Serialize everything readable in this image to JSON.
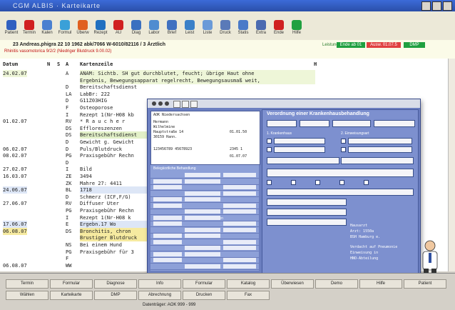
{
  "window": {
    "title": "CGM ALBIS · Karteikarte"
  },
  "toolbar": {
    "buttons": [
      {
        "label": "Patient",
        "icon": "pen-icon",
        "color": "#3060c0"
      },
      {
        "label": "Termin",
        "icon": "heart-icon",
        "color": "#d02020"
      },
      {
        "label": "Kalen",
        "icon": "calendar-icon",
        "color": "#4a80d0"
      },
      {
        "label": "Formul",
        "icon": "form-icon",
        "color": "#3aa0d8"
      },
      {
        "label": "Überw",
        "icon": "person-icon",
        "color": "#e06020"
      },
      {
        "label": "Rezept",
        "icon": "rx-icon",
        "color": "#2070c0"
      },
      {
        "label": "AU",
        "icon": "stop-icon",
        "color": "#d02020"
      },
      {
        "label": "Diag",
        "icon": "doc-icon",
        "color": "#3a70c0"
      },
      {
        "label": "Labor",
        "icon": "flask-icon",
        "color": "#508cd0"
      },
      {
        "label": "Brief",
        "icon": "pencil-icon",
        "color": "#4070c0"
      },
      {
        "label": "Leist",
        "icon": "chart-icon",
        "color": "#3a80c8"
      },
      {
        "label": "Liste",
        "icon": "list-icon",
        "color": "#6a9ad8"
      },
      {
        "label": "Druck",
        "icon": "printer-icon",
        "color": "#5a7ab8"
      },
      {
        "label": "Statis",
        "icon": "stats-icon",
        "color": "#4a7ac8"
      },
      {
        "label": "Extra",
        "icon": "disk-icon",
        "color": "#4a6ab0"
      },
      {
        "label": "Ende",
        "icon": "close-icon",
        "color": "#d02020"
      },
      {
        "label": "Hilfe",
        "icon": "check-icon",
        "color": "#20a040"
      }
    ]
  },
  "patient": {
    "name_line": "23 Andreas.phigra 22 10 1962 abk/7066 W-6010/82116 / 3 Ärztlich",
    "warning": "Rhinitis vasomotorica 9/2/2 (Niedriger Blutdruck 9.00.02)",
    "status_label": "Leistungen",
    "badges": [
      {
        "text": "Ende ab 01",
        "color": "#20a040"
      },
      {
        "text": "Ausw. 01.07.5",
        "color": "#e04040"
      },
      {
        "text": "DMP",
        "color": "#20a040"
      }
    ]
  },
  "grid": {
    "headers": {
      "datum": "Datum",
      "n": "N",
      "s": "S",
      "a": "A",
      "karte": "Kartenzeile",
      "extra": "H"
    },
    "rows": [
      {
        "datum": "24.02.07",
        "code": "A",
        "text": "ANAM: Sichtb. SH gut durchblutet, feucht; übrige Haut ohne",
        "hl": "#eef6d8"
      },
      {
        "datum": "",
        "code": "",
        "text": "Ergebnis, Bewegungsapparat regelrecht, Bewegungsausmaß weit,",
        "hl": "#eef6d8"
      },
      {
        "datum": "",
        "code": "D",
        "text": "Bereitschaftsdienst",
        "hl": ""
      },
      {
        "datum": "",
        "code": "LA",
        "text": "LabBr: 222",
        "hl": ""
      },
      {
        "datum": "",
        "code": "D",
        "text": "G11Z03HIG",
        "hl": ""
      },
      {
        "datum": "",
        "code": "F",
        "text": "Osteoporose",
        "hl": ""
      },
      {
        "datum": "",
        "code": "I",
        "text": "Rezept  1(Nr-H08 kb",
        "hl": ""
      },
      {
        "datum": "01.02.07",
        "code": "RV",
        "text": "* R a u c h e r",
        "hl": ""
      },
      {
        "datum": "",
        "code": "DS",
        "text": "Effloreszenzen",
        "hl": ""
      },
      {
        "datum": "",
        "code": "DS",
        "text": "Bereitschaftsdienst",
        "hl": "#e2f0c8"
      },
      {
        "datum": "",
        "code": "D",
        "text": "Gewicht g. Gewicht",
        "hl": ""
      },
      {
        "datum": "06.02.07",
        "code": "D",
        "text": "Puls/Blutdruck",
        "hl": ""
      },
      {
        "datum": "08.02.07",
        "code": "PG",
        "text": "Praxisgebühr Rechn",
        "hl": ""
      },
      {
        "datum": "",
        "code": "D",
        "text": "",
        "hl": ""
      },
      {
        "datum": "27.02.07",
        "code": "I",
        "text": "Bild",
        "hl": ""
      },
      {
        "datum": "16.03.07",
        "code": "ZE",
        "text": "3494",
        "hl": ""
      },
      {
        "datum": "",
        "code": "ZK",
        "text": "Mahre 27: 4411",
        "hl": ""
      },
      {
        "datum": "24.06.07",
        "code": "BL",
        "text": "1718",
        "hl": "#dde6f6"
      },
      {
        "datum": "",
        "code": "D",
        "text": "Schmerz (ICF,F/G)",
        "hl": ""
      },
      {
        "datum": "27.06.07",
        "code": "RV",
        "text": "Diffuser Uter",
        "hl": ""
      },
      {
        "datum": "",
        "code": "PG",
        "text": "Praxisgebühr Rechn",
        "hl": ""
      },
      {
        "datum": "",
        "code": "I",
        "text": "Rezept  1(Nr-H08 k",
        "hl": ""
      },
      {
        "datum": "17.06.07",
        "code": "E",
        "text": "Ergebn.17 Wo",
        "hl": "#dde6f6"
      },
      {
        "datum": "06.08.07",
        "code": "DS",
        "text": "Bronchitis, chron",
        "hl": "#f6eaa0"
      },
      {
        "datum": "",
        "code": "",
        "text": "Brustiger Blutdruck",
        "hl": "#f6eaa0"
      },
      {
        "datum": "",
        "code": "NS",
        "text": "Bei einem Hund",
        "hl": ""
      },
      {
        "datum": "",
        "code": "PG",
        "text": "Praxisgebühr für 3",
        "hl": ""
      },
      {
        "datum": "",
        "code": "F",
        "text": "",
        "hl": ""
      },
      {
        "datum": "06.08.07",
        "code": "WW",
        "text": "",
        "hl": ""
      }
    ]
  },
  "popup": {
    "form_title": "Verordnung einer Krankenhausbehandlung",
    "section1": "1. Krankenhaus",
    "section2": "2. Einweisungsart",
    "section_label": "Belegärztliche Behandlung",
    "section_notfall": "Notfall",
    "section_unfall": "Unfall, Unfallfolgen",
    "address": {
      "kasse": "AOK Niedersachsen",
      "line1": "Hermann",
      "line2": "Wilhelmine",
      "line3": "Hauptstraße 14",
      "line4": "30159 Hann.",
      "date": "01.01.50",
      "arzt": "123456789  45678923",
      "vk": "01.07.07",
      "ik": "2345 1"
    },
    "side": {
      "l1": "Hausarzt",
      "l2": "Arzt: 1550a",
      "l3": "BSH Hamburg e.",
      "l4": "Verdacht auf Pneumonie",
      "l5": "Einweisung in",
      "l6": "HNO-Abteilung"
    }
  },
  "footer": {
    "row1": [
      "Termin",
      "Formular",
      "Diagnose",
      "Info",
      "Formular",
      "Katalog",
      "Überwiesen",
      "Demo",
      "Hilfe",
      "Patient"
    ],
    "row2": [
      "Wählen",
      "Karteikarte",
      "DMP",
      "Abrechnung",
      "Drucken",
      "Fax"
    ],
    "key_hint": "Datenträger: AOK 999 - 999"
  }
}
